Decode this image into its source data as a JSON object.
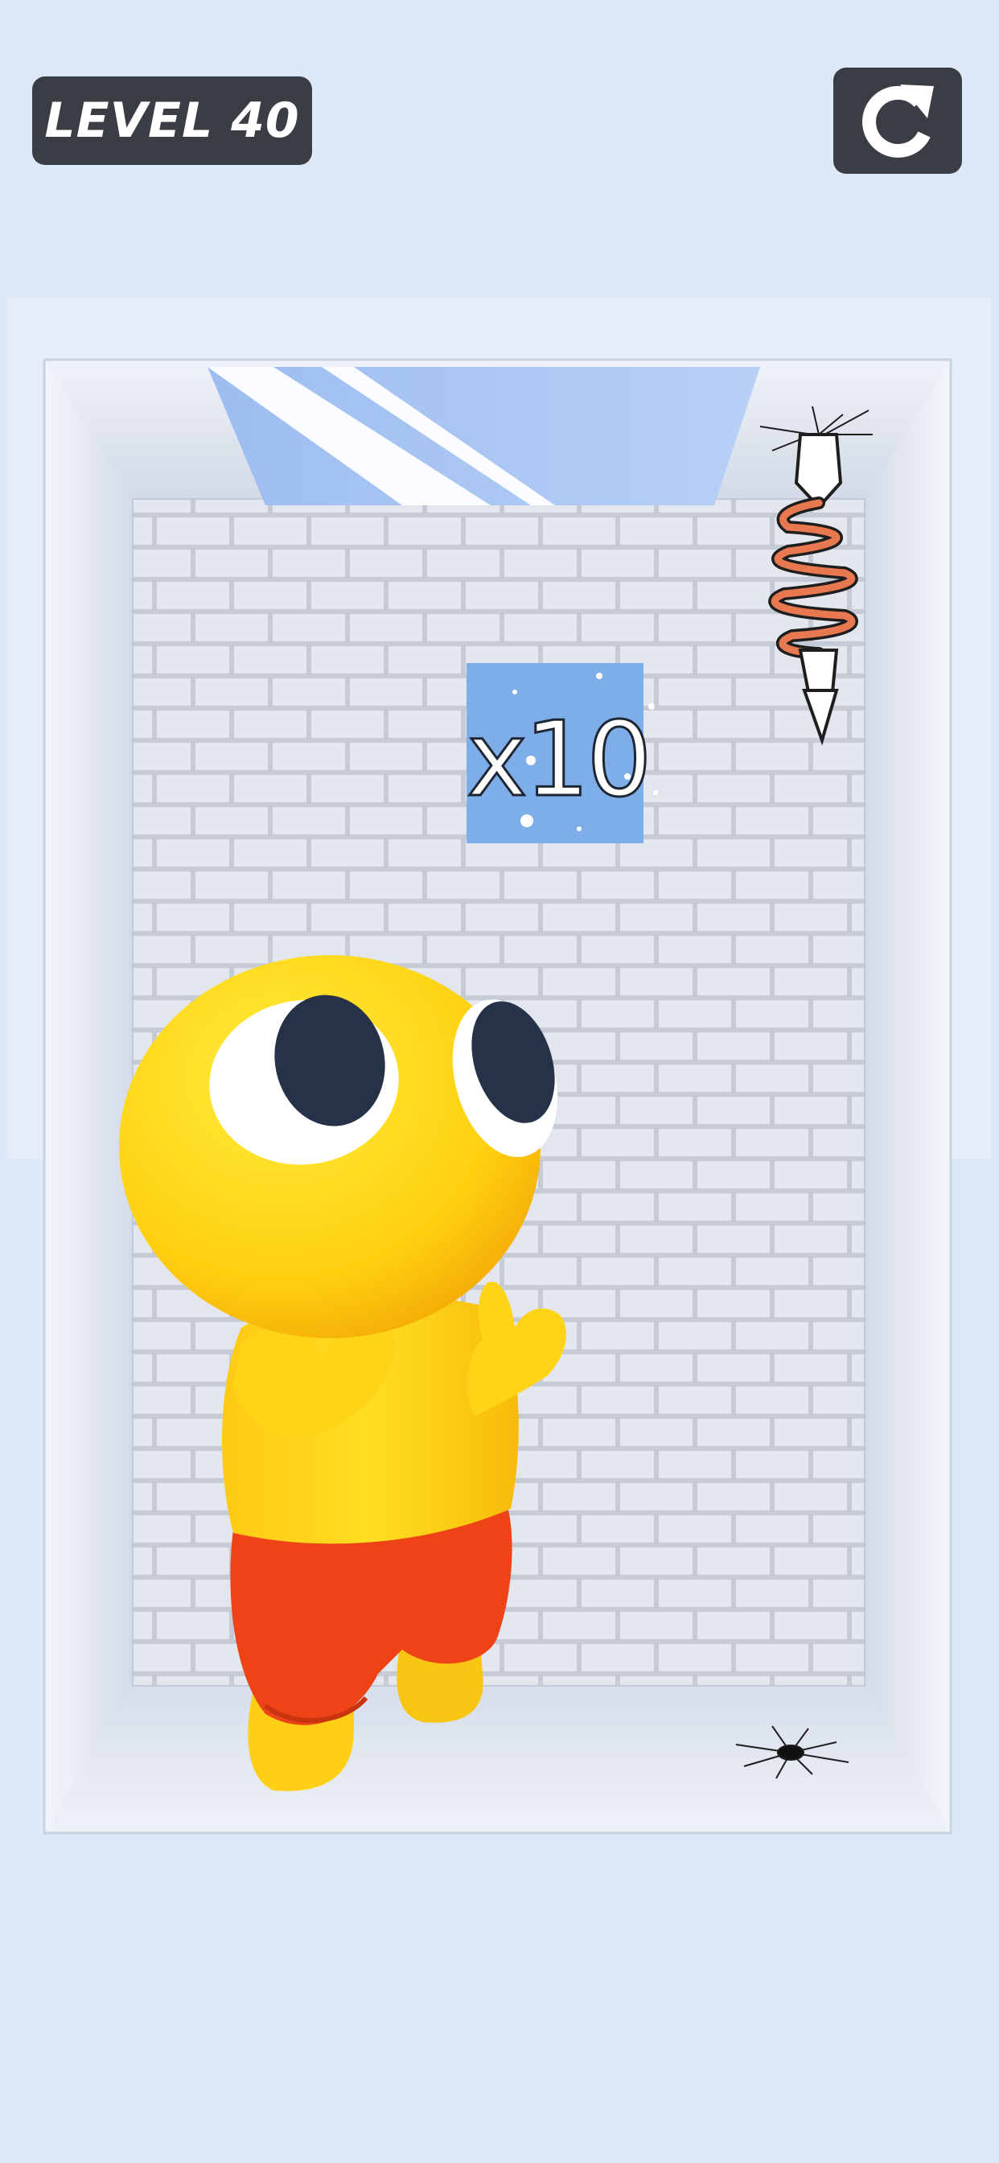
{
  "header": {
    "level_label": "LEVEL 40",
    "restart_icon": "restart-arrow-icon"
  },
  "room": {
    "multiplier_label": "x10",
    "skylight": "ceiling-glass-window",
    "hazard_top": "spring-spike-trap",
    "hazard_floor": "floor-crack-hole"
  },
  "character": "yellow-round-character-red-shorts",
  "colors": {
    "background": "#dde9f8",
    "button": "#3a3e44",
    "character": "#ffd814",
    "shorts": "#ee4317",
    "glass": "#a9c7f2",
    "multiplier_tile": "#7eaeea"
  }
}
